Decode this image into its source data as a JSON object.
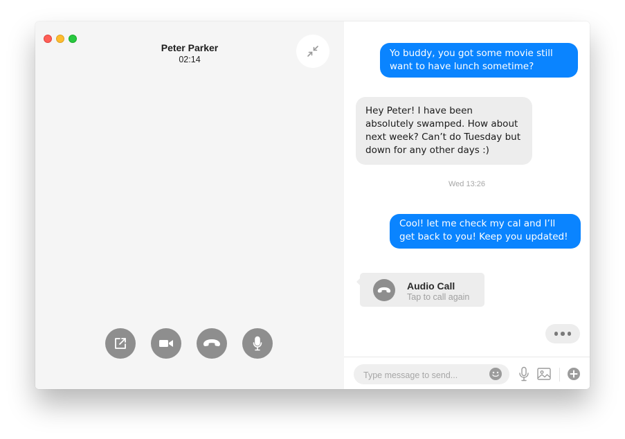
{
  "call": {
    "caller_name": "Peter Parker",
    "duration": "02:14",
    "controls": [
      {
        "id": "share",
        "icon": "external-share-icon"
      },
      {
        "id": "video",
        "icon": "video-camera-icon"
      },
      {
        "id": "hangup",
        "icon": "hang-up-phone-icon"
      },
      {
        "id": "mic",
        "icon": "microphone-icon"
      }
    ],
    "minimize_icon": "collapse-arrows-icon"
  },
  "chat": {
    "messages": [
      {
        "direction": "outgoing",
        "text": "Yo buddy, you got some movie still want to have lunch sometime?"
      },
      {
        "direction": "incoming",
        "text": "Hey Peter! I have been absolutely swamped. How about next week? Can’t do Tuesday but down for any other days :)"
      },
      {
        "direction": "outgoing",
        "text": "Cool! let me check my cal and I’ll get back to you! Keep you updated!"
      }
    ],
    "timestamp": "Wed 13:26",
    "audio_call": {
      "title": "Audio Call",
      "subtitle": "Tap to call again",
      "icon": "hang-up-phone-icon"
    },
    "typing_indicator_icon": "ellipsis-icon"
  },
  "composer": {
    "placeholder": "Type message to send...",
    "icons": [
      "emoji-icon",
      "microphone-icon",
      "image-icon",
      "plus-circle-icon"
    ]
  },
  "colors": {
    "outgoing_bubble": "#0a84ff",
    "incoming_bubble": "#ededed",
    "call_pane_bg": "#f5f5f5",
    "control_button": "#8e8e8e"
  }
}
